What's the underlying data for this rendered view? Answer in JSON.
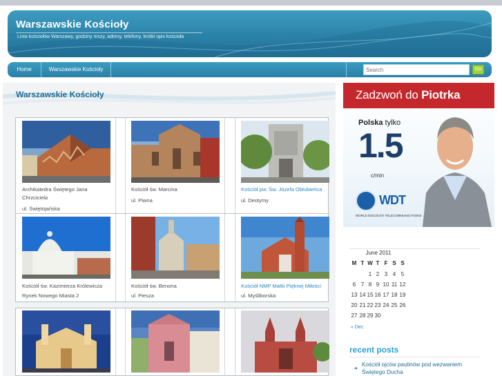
{
  "header": {
    "site_title": "Warszawskie Kościoły",
    "site_description": "Lista kościołów Warszawy, godziny mszy, adresy, telefony, krótki opis kościoła"
  },
  "nav": {
    "home": "Home",
    "churches": "Warszawskie Kościoły",
    "search_placeholder": "Search",
    "search_button": "Go"
  },
  "main": {
    "page_title": "Warszawskie Kościoły",
    "churches": [
      {
        "name_lines": [
          "Archikatedra Świętego Jana",
          "Chrzciciela"
        ],
        "street": "ul. Świętojańska",
        "link": false
      },
      {
        "name_lines": [
          "Kościół św. Marcina"
        ],
        "street": "ul. Piwna",
        "link": false
      },
      {
        "name_lines": [
          "Kościół pw. Św. Józefa Oblubieńca"
        ],
        "street": "ul. Deotymy",
        "link": true
      },
      {
        "name_lines": [
          "Kościół św. Kazimierza Królewicza"
        ],
        "street": "Rynek Nowego Miasta 2",
        "link": false
      },
      {
        "name_lines": [
          "Kościół św. Benona"
        ],
        "street": "ul. Piesza",
        "link": false
      },
      {
        "name_lines": [
          "Kościół NMP Matki Pięknej Miłości"
        ],
        "street": "ul. Myśliborska",
        "link": true
      }
    ]
  },
  "ad": {
    "headline_plain": "Zadzwoń do ",
    "headline_bold": "Piotrka",
    "country": "Polska",
    "country_suffix": " tylko",
    "price": "1.5",
    "unit": "c/min",
    "brand": "WDT",
    "brand_sub": "WORLD DISCOUNT TELECOMMUNICATIONS"
  },
  "calendar": {
    "caption": "June 2011",
    "weekdays": [
      "M",
      "T",
      "W",
      "T",
      "F",
      "S",
      "S"
    ],
    "weeks": [
      [
        "",
        "",
        "1",
        "2",
        "3",
        "4",
        "5"
      ],
      [
        "6",
        "7",
        "8",
        "9",
        "10",
        "11",
        "12"
      ],
      [
        "13",
        "14",
        "15",
        "16",
        "17",
        "18",
        "19"
      ],
      [
        "20",
        "21",
        "22",
        "23",
        "24",
        "25",
        "26"
      ],
      [
        "27",
        "28",
        "29",
        "30",
        "",
        "",
        ""
      ]
    ],
    "prev_link": "« Dec"
  },
  "recent_posts": {
    "title": "recent posts",
    "items": [
      "Kościół ojców paulinów pod wezwaniem Świętego Ducha"
    ]
  },
  "colors": {
    "header_blue": "#2b82a8",
    "title_blue": "#1f6a94",
    "link_blue": "#2a86c6",
    "search_green": "#a4d23b",
    "ad_red": "#c4282c"
  }
}
